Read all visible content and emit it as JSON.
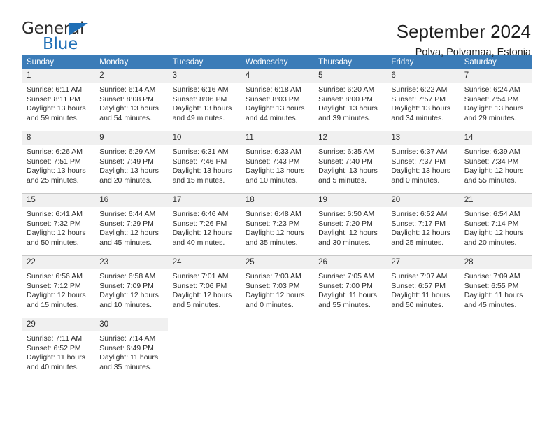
{
  "brand": {
    "line1": "General",
    "line2": "Blue",
    "accent_color": "#1f6fb6"
  },
  "header": {
    "title": "September 2024",
    "subtitle": "Polva, Polvamaa, Estonia"
  },
  "calendar": {
    "header_color": "#3b7cb8",
    "daynum_bar_color": "#f0f0f0",
    "weekdays": [
      "Sunday",
      "Monday",
      "Tuesday",
      "Wednesday",
      "Thursday",
      "Friday",
      "Saturday"
    ],
    "labels": {
      "sunrise_prefix": "Sunrise: ",
      "sunset_prefix": "Sunset: ",
      "daylight_prefix": "Daylight: "
    },
    "weeks": [
      [
        {
          "day": "1",
          "sunrise": "Sunrise: 6:11 AM",
          "sunset": "Sunset: 8:11 PM",
          "daylight": "Daylight: 13 hours and 59 minutes."
        },
        {
          "day": "2",
          "sunrise": "Sunrise: 6:14 AM",
          "sunset": "Sunset: 8:08 PM",
          "daylight": "Daylight: 13 hours and 54 minutes."
        },
        {
          "day": "3",
          "sunrise": "Sunrise: 6:16 AM",
          "sunset": "Sunset: 8:06 PM",
          "daylight": "Daylight: 13 hours and 49 minutes."
        },
        {
          "day": "4",
          "sunrise": "Sunrise: 6:18 AM",
          "sunset": "Sunset: 8:03 PM",
          "daylight": "Daylight: 13 hours and 44 minutes."
        },
        {
          "day": "5",
          "sunrise": "Sunrise: 6:20 AM",
          "sunset": "Sunset: 8:00 PM",
          "daylight": "Daylight: 13 hours and 39 minutes."
        },
        {
          "day": "6",
          "sunrise": "Sunrise: 6:22 AM",
          "sunset": "Sunset: 7:57 PM",
          "daylight": "Daylight: 13 hours and 34 minutes."
        },
        {
          "day": "7",
          "sunrise": "Sunrise: 6:24 AM",
          "sunset": "Sunset: 7:54 PM",
          "daylight": "Daylight: 13 hours and 29 minutes."
        }
      ],
      [
        {
          "day": "8",
          "sunrise": "Sunrise: 6:26 AM",
          "sunset": "Sunset: 7:51 PM",
          "daylight": "Daylight: 13 hours and 25 minutes."
        },
        {
          "day": "9",
          "sunrise": "Sunrise: 6:29 AM",
          "sunset": "Sunset: 7:49 PM",
          "daylight": "Daylight: 13 hours and 20 minutes."
        },
        {
          "day": "10",
          "sunrise": "Sunrise: 6:31 AM",
          "sunset": "Sunset: 7:46 PM",
          "daylight": "Daylight: 13 hours and 15 minutes."
        },
        {
          "day": "11",
          "sunrise": "Sunrise: 6:33 AM",
          "sunset": "Sunset: 7:43 PM",
          "daylight": "Daylight: 13 hours and 10 minutes."
        },
        {
          "day": "12",
          "sunrise": "Sunrise: 6:35 AM",
          "sunset": "Sunset: 7:40 PM",
          "daylight": "Daylight: 13 hours and 5 minutes."
        },
        {
          "day": "13",
          "sunrise": "Sunrise: 6:37 AM",
          "sunset": "Sunset: 7:37 PM",
          "daylight": "Daylight: 13 hours and 0 minutes."
        },
        {
          "day": "14",
          "sunrise": "Sunrise: 6:39 AM",
          "sunset": "Sunset: 7:34 PM",
          "daylight": "Daylight: 12 hours and 55 minutes."
        }
      ],
      [
        {
          "day": "15",
          "sunrise": "Sunrise: 6:41 AM",
          "sunset": "Sunset: 7:32 PM",
          "daylight": "Daylight: 12 hours and 50 minutes."
        },
        {
          "day": "16",
          "sunrise": "Sunrise: 6:44 AM",
          "sunset": "Sunset: 7:29 PM",
          "daylight": "Daylight: 12 hours and 45 minutes."
        },
        {
          "day": "17",
          "sunrise": "Sunrise: 6:46 AM",
          "sunset": "Sunset: 7:26 PM",
          "daylight": "Daylight: 12 hours and 40 minutes."
        },
        {
          "day": "18",
          "sunrise": "Sunrise: 6:48 AM",
          "sunset": "Sunset: 7:23 PM",
          "daylight": "Daylight: 12 hours and 35 minutes."
        },
        {
          "day": "19",
          "sunrise": "Sunrise: 6:50 AM",
          "sunset": "Sunset: 7:20 PM",
          "daylight": "Daylight: 12 hours and 30 minutes."
        },
        {
          "day": "20",
          "sunrise": "Sunrise: 6:52 AM",
          "sunset": "Sunset: 7:17 PM",
          "daylight": "Daylight: 12 hours and 25 minutes."
        },
        {
          "day": "21",
          "sunrise": "Sunrise: 6:54 AM",
          "sunset": "Sunset: 7:14 PM",
          "daylight": "Daylight: 12 hours and 20 minutes."
        }
      ],
      [
        {
          "day": "22",
          "sunrise": "Sunrise: 6:56 AM",
          "sunset": "Sunset: 7:12 PM",
          "daylight": "Daylight: 12 hours and 15 minutes."
        },
        {
          "day": "23",
          "sunrise": "Sunrise: 6:58 AM",
          "sunset": "Sunset: 7:09 PM",
          "daylight": "Daylight: 12 hours and 10 minutes."
        },
        {
          "day": "24",
          "sunrise": "Sunrise: 7:01 AM",
          "sunset": "Sunset: 7:06 PM",
          "daylight": "Daylight: 12 hours and 5 minutes."
        },
        {
          "day": "25",
          "sunrise": "Sunrise: 7:03 AM",
          "sunset": "Sunset: 7:03 PM",
          "daylight": "Daylight: 12 hours and 0 minutes."
        },
        {
          "day": "26",
          "sunrise": "Sunrise: 7:05 AM",
          "sunset": "Sunset: 7:00 PM",
          "daylight": "Daylight: 11 hours and 55 minutes."
        },
        {
          "day": "27",
          "sunrise": "Sunrise: 7:07 AM",
          "sunset": "Sunset: 6:57 PM",
          "daylight": "Daylight: 11 hours and 50 minutes."
        },
        {
          "day": "28",
          "sunrise": "Sunrise: 7:09 AM",
          "sunset": "Sunset: 6:55 PM",
          "daylight": "Daylight: 11 hours and 45 minutes."
        }
      ],
      [
        {
          "day": "29",
          "sunrise": "Sunrise: 7:11 AM",
          "sunset": "Sunset: 6:52 PM",
          "daylight": "Daylight: 11 hours and 40 minutes."
        },
        {
          "day": "30",
          "sunrise": "Sunrise: 7:14 AM",
          "sunset": "Sunset: 6:49 PM",
          "daylight": "Daylight: 11 hours and 35 minutes."
        },
        {
          "day": "",
          "sunrise": "",
          "sunset": "",
          "daylight": ""
        },
        {
          "day": "",
          "sunrise": "",
          "sunset": "",
          "daylight": ""
        },
        {
          "day": "",
          "sunrise": "",
          "sunset": "",
          "daylight": ""
        },
        {
          "day": "",
          "sunrise": "",
          "sunset": "",
          "daylight": ""
        },
        {
          "day": "",
          "sunrise": "",
          "sunset": "",
          "daylight": ""
        }
      ]
    ]
  }
}
